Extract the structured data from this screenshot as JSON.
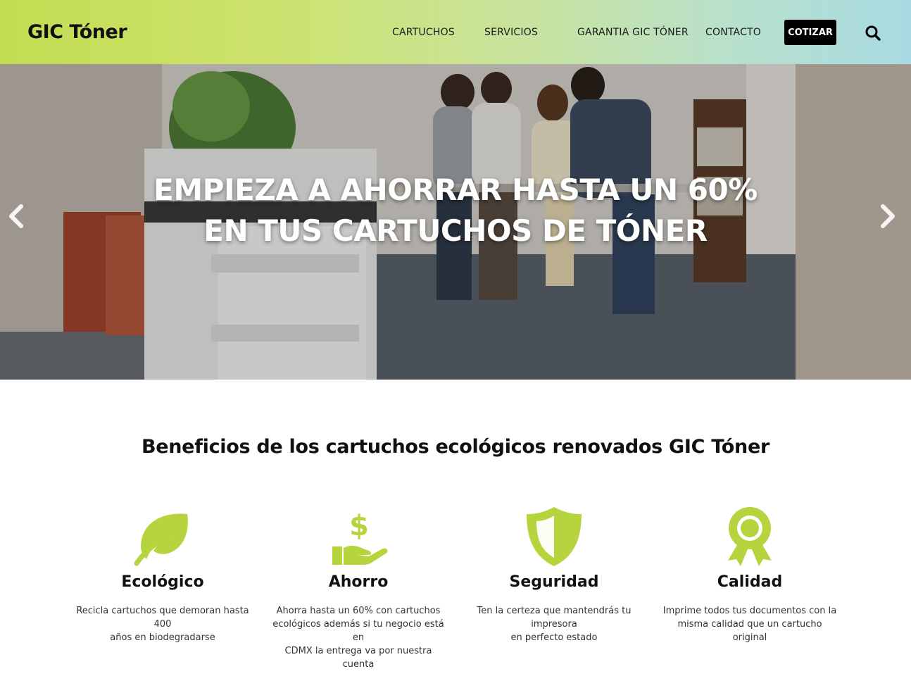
{
  "brand": {
    "logo": "GIC Tóner",
    "accent": "#b5d43d"
  },
  "nav": {
    "items": [
      "CARTUCHOS",
      "SERVICIOS",
      "GARANTIA GIC TÓNER",
      "CONTACTO"
    ],
    "cta": "COTIZAR",
    "search_icon": "search-icon"
  },
  "hero": {
    "line1": "EMPIEZA A AHORRAR HASTA UN 60%",
    "line2": "EN TUS CARTUCHOS DE TÓNER",
    "prev_icon": "chevron-left-icon",
    "next_icon": "chevron-right-icon"
  },
  "benefits": {
    "heading": "Beneficios de los cartuchos ecológicos renovados GIC Tóner",
    "items": [
      {
        "icon": "leaf-icon",
        "title": "Ecológico",
        "line1": "Recicla cartuchos que demoran hasta 400",
        "line2": "años en biodegradarse",
        "line3": ""
      },
      {
        "icon": "money-hand-icon",
        "title": "Ahorro",
        "line1": "Ahorra hasta un 60% con cartuchos",
        "line2": "ecológicos además si tu negocio está en",
        "line3": "CDMX la entrega va por nuestra cuenta"
      },
      {
        "icon": "shield-icon",
        "title": "Seguridad",
        "line1": "Ten la certeza que mantendrás tu impresora",
        "line2": "en perfecto estado",
        "line3": ""
      },
      {
        "icon": "award-ribbon-icon",
        "title": "Calidad",
        "line1": "Imprime todos tus documentos con la",
        "line2": "misma calidad que un cartucho original",
        "line3": ""
      }
    ]
  }
}
